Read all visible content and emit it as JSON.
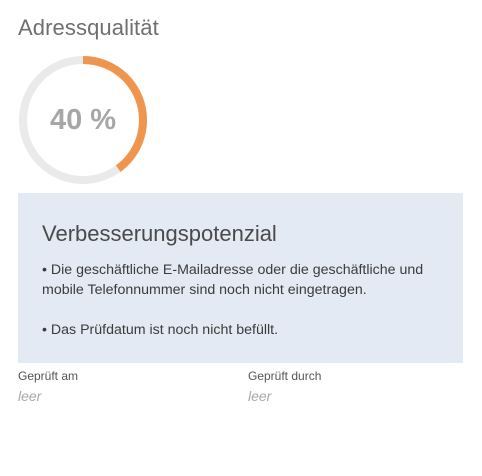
{
  "section": {
    "title": "Adressqualität"
  },
  "quality": {
    "percent": 40,
    "display": "40 %",
    "colors": {
      "track": "#eaeaea",
      "progress": "#f0954d"
    }
  },
  "improvement": {
    "title": "Verbesserungspotenzial",
    "items": [
      "• Die geschäftliche E-Mailadresse oder die geschäftliche und mobile Telefonnummer sind noch nicht eingetragen.",
      "• Das Prüfdatum ist noch nicht befüllt."
    ],
    "background": "#e3eaf4"
  },
  "meta": {
    "checked_on": {
      "label": "Geprüft am",
      "value": "leer"
    },
    "checked_by": {
      "label": "Geprüft durch",
      "value": "leer"
    }
  }
}
